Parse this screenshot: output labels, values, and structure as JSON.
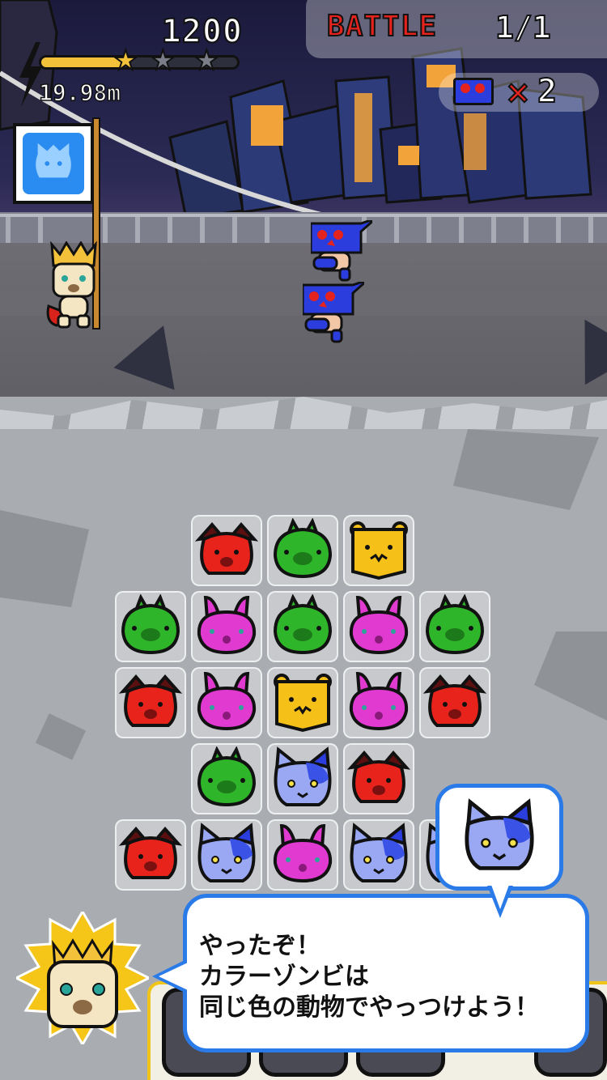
{
  "hud": {
    "score": "1200",
    "progress_fraction": 0.42,
    "stars_earned": 1,
    "stars_total": 3,
    "distance": "19.98m"
  },
  "battle": {
    "label": "BATTLE",
    "count": "1/1"
  },
  "zombie_counter": {
    "icon": "blue-zombie-icon",
    "multiplier": "×",
    "count": "2"
  },
  "flag": {
    "color": "#2a8bf0",
    "icon": "blue-cat-icon"
  },
  "board": {
    "rows": [
      [
        null,
        "dog-red",
        "pig-green",
        "bear-yellow",
        null,
        null
      ],
      [
        "pig-green",
        "rabbit-pink",
        "pig-green",
        "rabbit-pink",
        "pig-green",
        null
      ],
      [
        "dog-red",
        "rabbit-pink",
        "bear-yellow",
        "rabbit-pink",
        "dog-red",
        null
      ],
      [
        null,
        "pig-green",
        "cat-blue",
        "dog-red",
        null,
        null
      ],
      [
        "dog-red",
        "cat-blue",
        "rabbit-pink",
        "cat-blue",
        "cat-blue",
        null
      ]
    ],
    "colors": {
      "dog-red": "#e8231c",
      "pig-green": "#2fb52a",
      "bear-yellow": "#f5c018",
      "rabbit-pink": "#e03ad0",
      "cat-blue": "#9aa8f4"
    }
  },
  "hint": {
    "icon": "cat-blue",
    "message": "やったぞ！\nカラーゾンビは\n同じ色の動物でやっつけよう！"
  },
  "theme": {
    "accent_blue": "#2a7ae8",
    "battle_red": "#e4231e",
    "star_gold": "#f3c23a"
  }
}
